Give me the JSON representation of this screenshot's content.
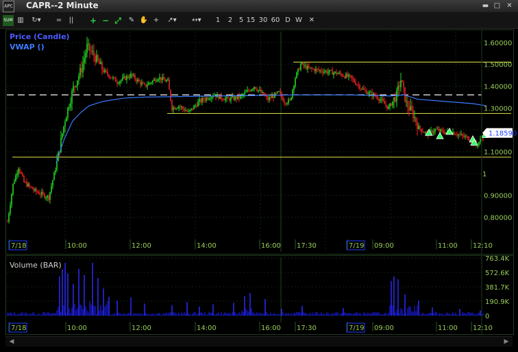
{
  "window": {
    "title": "CAPR--2 Minute",
    "app_icon_text": "APC",
    "buttons": {
      "minimize": "▬",
      "restore": "□",
      "close": "✕"
    }
  },
  "toolbar": {
    "items": [
      {
        "name": "sum-button",
        "label": "SUM"
      },
      {
        "name": "chart-type-button",
        "label": "▥"
      },
      {
        "name": "refresh-dropdown",
        "label": "↻▾"
      },
      {
        "name": "equals-button",
        "label": "="
      },
      {
        "name": "columns-button",
        "label": "||"
      },
      {
        "name": "zoom-in-button",
        "label": "+"
      },
      {
        "name": "zoom-out-button",
        "label": "−"
      },
      {
        "name": "fit-button",
        "label": "⤢"
      },
      {
        "name": "pen-tool",
        "label": "✎"
      },
      {
        "name": "hand-tool",
        "label": "✋"
      },
      {
        "name": "crosshair-tool",
        "label": "+"
      },
      {
        "name": "line-tool-dropdown",
        "label": "↗▾"
      },
      {
        "name": "pan-dropdown",
        "label": "↔▾"
      }
    ],
    "intervals": [
      "1",
      "2",
      "5",
      "15",
      "30",
      "60",
      "D",
      "W"
    ],
    "close_label": "✕"
  },
  "legend": {
    "price": "Price (Candle)",
    "vwap": "VWAP ()",
    "volume": "Volume (BAR)"
  },
  "price_axis": {
    "labels": [
      "1.60000",
      "1.50000",
      "1.40000",
      "1.30000",
      "1.18590",
      "1.10000",
      "1",
      "0.90000",
      "0.80000"
    ],
    "current_price": "1.18590"
  },
  "volume_axis": {
    "labels": [
      "763.4K",
      "572.6K",
      "381.7K",
      "190.9K",
      "0"
    ]
  },
  "time_axis": {
    "labels": [
      "7/18",
      "10:00",
      "12:00",
      "14:00",
      "16:00",
      "17:30",
      "7/19",
      "09:00",
      "11:00",
      "12:10"
    ]
  },
  "colors": {
    "up": "#22dd22",
    "down": "#ee2222",
    "vwap": "#3d7bff",
    "volume": "#1a1aee",
    "hline_yellow": "#e6e64a",
    "dashed": "#e0e0e0",
    "axis_text": "#9acd5a"
  },
  "chart_data": [
    {
      "type": "candlestick",
      "title": "Price (Candle)",
      "ylim": [
        0.72,
        1.65
      ],
      "reference_lines": {
        "dashed": 1.36,
        "yellow": [
          1.51,
          1.275,
          1.075
        ]
      },
      "x_sessions": [
        "7/18",
        "7/19"
      ],
      "price_path": [
        [
          0,
          0.78
        ],
        [
          8,
          0.95
        ],
        [
          16,
          1.03
        ],
        [
          24,
          0.96
        ],
        [
          40,
          0.92
        ],
        [
          60,
          0.89
        ],
        [
          72,
          1.05
        ],
        [
          84,
          1.25
        ],
        [
          96,
          1.39
        ],
        [
          108,
          1.48
        ],
        [
          116,
          1.58
        ],
        [
          124,
          1.55
        ],
        [
          140,
          1.47
        ],
        [
          160,
          1.42
        ],
        [
          180,
          1.45
        ],
        [
          200,
          1.4
        ],
        [
          220,
          1.44
        ],
        [
          234,
          1.42
        ],
        [
          240,
          1.3
        ],
        [
          250,
          1.31
        ],
        [
          264,
          1.28
        ],
        [
          280,
          1.33
        ],
        [
          300,
          1.36
        ],
        [
          320,
          1.34
        ],
        [
          340,
          1.35
        ],
        [
          360,
          1.4
        ],
        [
          380,
          1.34
        ],
        [
          396,
          1.37
        ],
        [
          404,
          1.33
        ],
        [
          412,
          1.33
        ],
        [
          420,
          1.44
        ],
        [
          428,
          1.5
        ],
        [
          440,
          1.48
        ],
        [
          460,
          1.47
        ],
        [
          480,
          1.46
        ],
        [
          500,
          1.44
        ],
        [
          520,
          1.38
        ],
        [
          540,
          1.35
        ],
        [
          556,
          1.3
        ],
        [
          568,
          1.36
        ],
        [
          574,
          1.43
        ],
        [
          582,
          1.32
        ],
        [
          592,
          1.27
        ],
        [
          600,
          1.21
        ],
        [
          612,
          1.18
        ],
        [
          624,
          1.2
        ],
        [
          636,
          1.19
        ],
        [
          650,
          1.19
        ],
        [
          664,
          1.17
        ],
        [
          676,
          1.16
        ],
        [
          684,
          1.13
        ],
        [
          700,
          1.185
        ]
      ],
      "vwap_path": [
        [
          72,
          1.05
        ],
        [
          84,
          1.16
        ],
        [
          96,
          1.24
        ],
        [
          108,
          1.28
        ],
        [
          120,
          1.31
        ],
        [
          140,
          1.33
        ],
        [
          170,
          1.345
        ],
        [
          200,
          1.35
        ],
        [
          240,
          1.352
        ],
        [
          300,
          1.355
        ],
        [
          360,
          1.357
        ],
        [
          420,
          1.36
        ],
        [
          500,
          1.36
        ],
        [
          560,
          1.355
        ],
        [
          580,
          1.36
        ],
        [
          600,
          1.34
        ],
        [
          640,
          1.33
        ],
        [
          680,
          1.32
        ],
        [
          700,
          1.31
        ]
      ],
      "markers": [
        [
          616,
          1.19
        ],
        [
          632,
          1.175
        ],
        [
          646,
          1.195
        ],
        [
          680,
          1.16
        ],
        [
          682,
          1.145
        ],
        [
          698,
          1.18
        ]
      ]
    },
    {
      "type": "bar",
      "title": "Volume (BAR)",
      "ylim": [
        0,
        763400
      ],
      "spikes": [
        [
          76,
          520000
        ],
        [
          80,
          610000
        ],
        [
          84,
          700000
        ],
        [
          88,
          560000
        ],
        [
          96,
          420000
        ],
        [
          104,
          620000
        ],
        [
          112,
          540000
        ],
        [
          124,
          700000
        ],
        [
          132,
          500000
        ],
        [
          140,
          360000
        ],
        [
          148,
          250000
        ],
        [
          160,
          200000
        ],
        [
          180,
          240000
        ],
        [
          200,
          160000
        ],
        [
          240,
          140000
        ],
        [
          262,
          180000
        ],
        [
          280,
          120000
        ],
        [
          300,
          150000
        ],
        [
          330,
          170000
        ],
        [
          346,
          260000
        ],
        [
          354,
          300000
        ],
        [
          376,
          220000
        ],
        [
          400,
          90000
        ],
        [
          430,
          130000
        ],
        [
          490,
          100000
        ],
        [
          560,
          460000
        ],
        [
          564,
          520000
        ],
        [
          570,
          480000
        ],
        [
          580,
          280000
        ],
        [
          600,
          200000
        ],
        [
          620,
          110000
        ],
        [
          660,
          90000
        ],
        [
          690,
          70000
        ]
      ]
    }
  ]
}
